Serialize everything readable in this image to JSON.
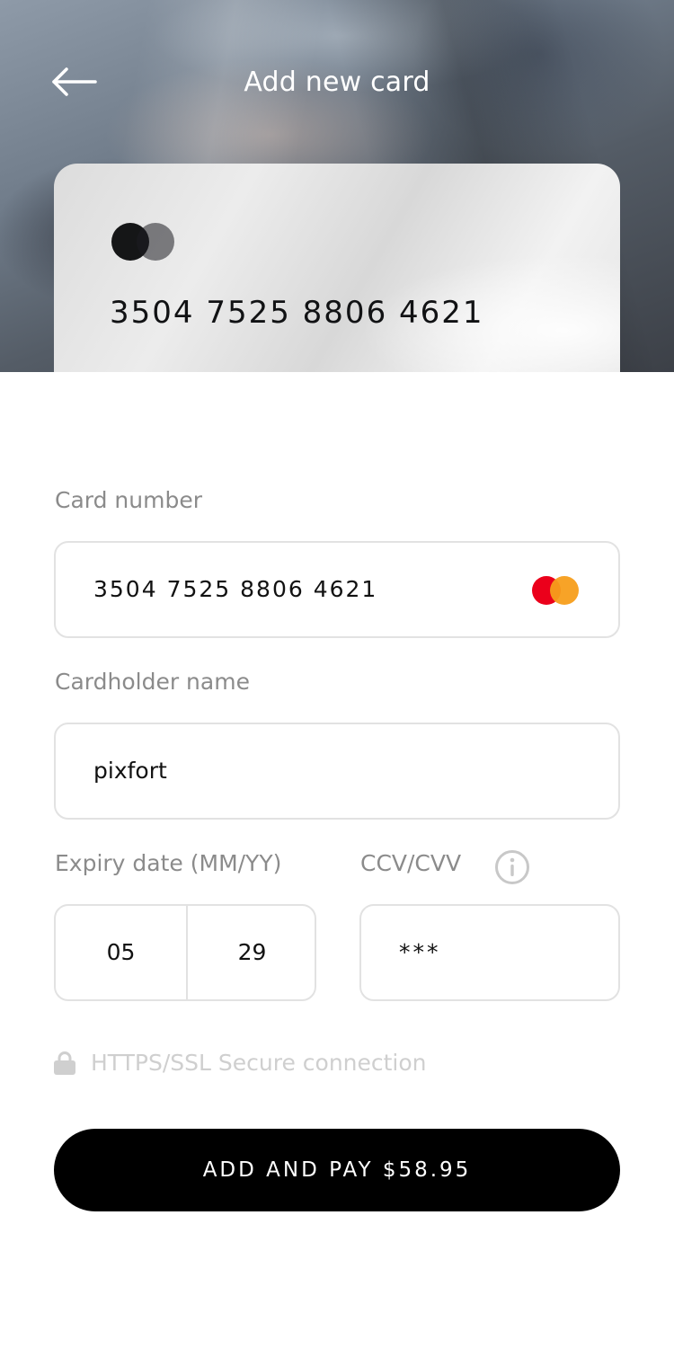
{
  "header": {
    "title": "Add new card",
    "back_icon": "arrow-left-icon"
  },
  "card_preview": {
    "number": "3504 7525 8806 4621",
    "logo_icon": "card-brand-circles-icon"
  },
  "form": {
    "card_number": {
      "label": "Card number",
      "value": "3504 7525 8806 4621",
      "brand_icon": "mastercard-icon"
    },
    "cardholder": {
      "label": "Cardholder name",
      "value": "pixfort"
    },
    "expiry": {
      "label": "Expiry date (MM/YY)",
      "month": "05",
      "year": "29"
    },
    "cvv": {
      "label": "CCV/CVV",
      "value": "***",
      "info_icon": "info-icon"
    }
  },
  "secure": {
    "icon": "lock-icon",
    "text": "HTTPS/SSL Secure connection"
  },
  "pay_button": {
    "label": "ADD AND PAY $58.95"
  },
  "colors": {
    "accent": "#000000",
    "label": "#8b8b8b",
    "border": "#e2e2e2",
    "mastercard_red": "#eb001b",
    "mastercard_orange": "#f79e1b"
  }
}
